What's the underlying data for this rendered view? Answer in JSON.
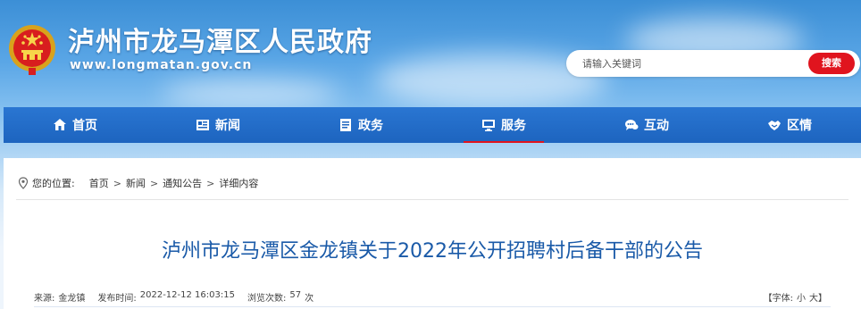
{
  "header": {
    "site_title": "泸州市龙马潭区人民政府",
    "site_url": "www.longmatan.gov.cn",
    "emblem_icon": "national-emblem-icon"
  },
  "search": {
    "placeholder": "请输入关键词",
    "button_label": "搜索"
  },
  "nav": {
    "items": [
      {
        "label": "首页",
        "icon": "home-icon"
      },
      {
        "label": "新闻",
        "icon": "newspaper-icon"
      },
      {
        "label": "政务",
        "icon": "document-icon"
      },
      {
        "label": "服务",
        "icon": "monitor-icon",
        "active": true
      },
      {
        "label": "互动",
        "icon": "chat-icon"
      },
      {
        "label": "区情",
        "icon": "handshake-icon"
      }
    ]
  },
  "breadcrumb": {
    "label": "您的位置:",
    "items": [
      "首页",
      "新闻",
      "通知公告",
      "详细内容"
    ],
    "separator": ">"
  },
  "article": {
    "title": "泸州市龙马潭区金龙镇关于2022年公开招聘村后备干部的公告",
    "source_label": "来源:",
    "source": "金龙镇",
    "published_label": "发布时间:",
    "published": "2022-12-12 16:03:15",
    "views_label": "浏览次数:",
    "views": "57",
    "views_unit": "次",
    "font_label": "【字体:",
    "font_small": "小",
    "font_large": "大】"
  },
  "colors": {
    "nav_bg": "#1d64bf",
    "accent_red": "#e0141e",
    "title_blue": "#1a5aa8"
  }
}
